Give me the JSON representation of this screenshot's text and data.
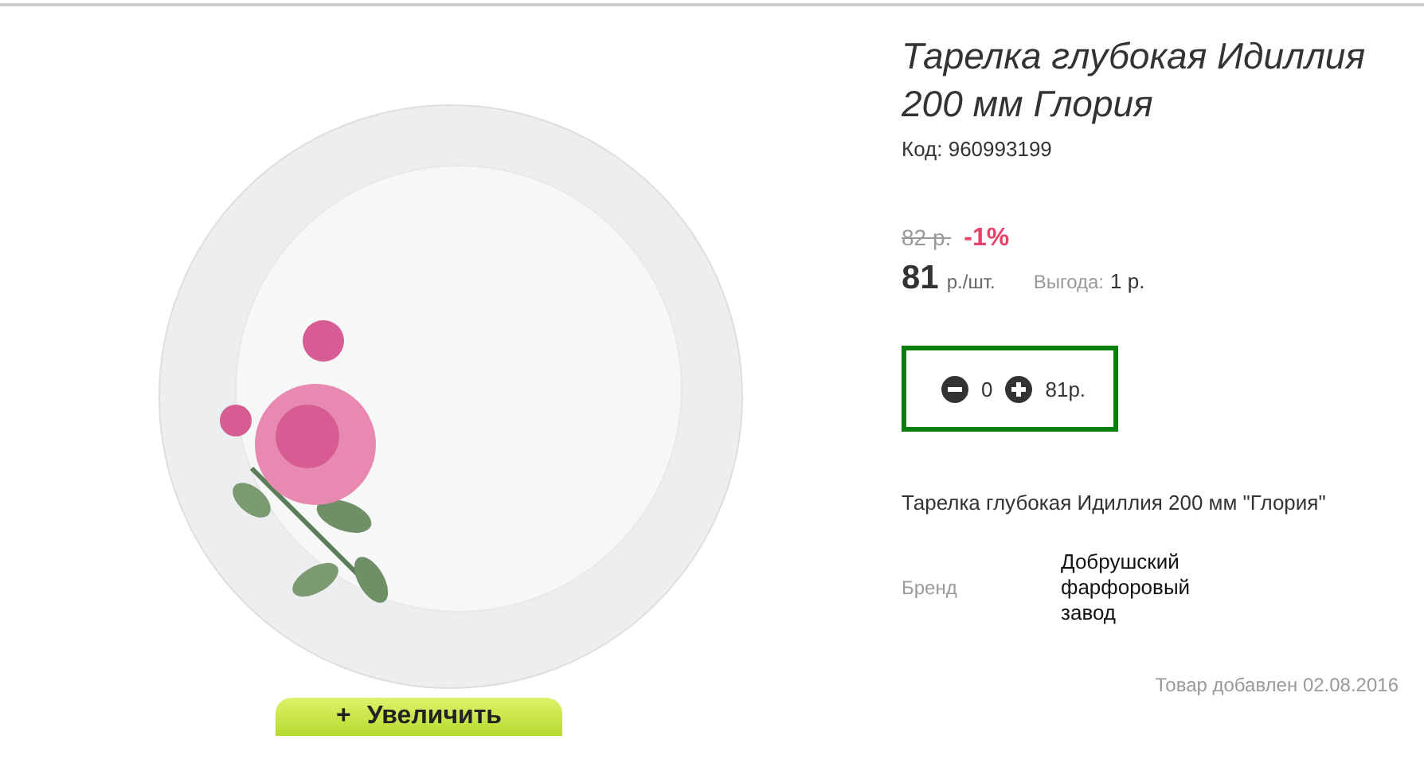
{
  "product": {
    "title": "Тарелка глубокая Идиллия 200 мм Глория",
    "code_label": "Код:",
    "code": "960993199"
  },
  "price": {
    "old": "82 р.",
    "discount": "-1%",
    "current": "81",
    "unit": "р./шт.",
    "savings_label": "Выгода:",
    "savings": "1 р."
  },
  "quantity": {
    "value": "0",
    "total": "81р."
  },
  "description": "Тарелка глубокая Идиллия 200 мм \"Глория\"",
  "properties": [
    {
      "name": "Бренд",
      "value": "Добрушский фарфоровый завод"
    }
  ],
  "added": "Товар добавлен 02.08.2016",
  "zoom_button": {
    "icon": "+",
    "label": "Увеличить"
  }
}
